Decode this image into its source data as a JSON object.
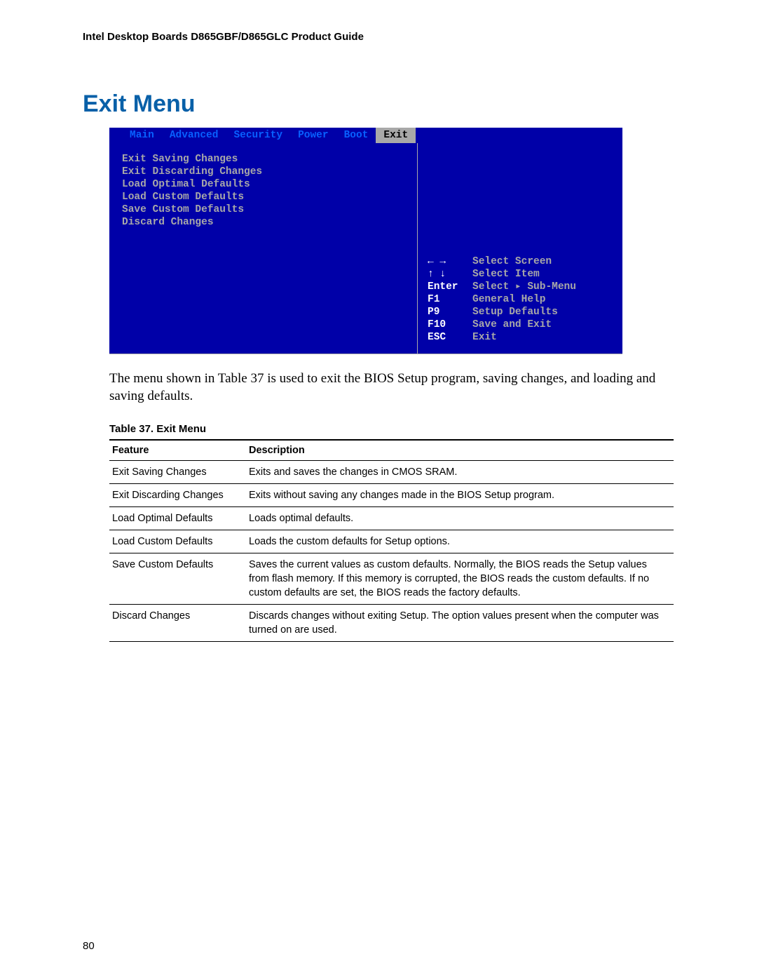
{
  "header": "Intel Desktop Boards D865GBF/D865GLC Product Guide",
  "section_title": "Exit Menu",
  "bios": {
    "tabs": [
      "Main",
      "Advanced",
      "Security",
      "Power",
      "Boot",
      "Exit"
    ],
    "active_tab_index": 5,
    "menu_items": [
      "Exit Saving Changes",
      "Exit Discarding Changes",
      "Load Optimal Defaults",
      "Load Custom Defaults",
      "Save Custom Defaults",
      "Discard Changes"
    ],
    "help": [
      {
        "key": "←  →",
        "label": "Select Screen"
      },
      {
        "key": "↑  ↓",
        "label": "Select Item"
      },
      {
        "key": "Enter",
        "label": "Select ▸ Sub-Menu"
      },
      {
        "key": "F1",
        "label": "General Help"
      },
      {
        "key": "P9",
        "label": "Setup Defaults"
      },
      {
        "key": "F10",
        "label": "Save and Exit"
      },
      {
        "key": "ESC",
        "label": "Exit"
      }
    ]
  },
  "caption": "The menu shown in Table 37 is used to exit the BIOS Setup program, saving changes, and loading and saving defaults.",
  "table_title": "Table 37.    Exit Menu",
  "table_headers": [
    "Feature",
    "Description"
  ],
  "table_rows": [
    {
      "feature": "Exit Saving Changes",
      "desc": "Exits and saves the changes in CMOS SRAM."
    },
    {
      "feature": "Exit Discarding Changes",
      "desc": "Exits without saving any changes made in the BIOS Setup program."
    },
    {
      "feature": "Load Optimal Defaults",
      "desc": "Loads optimal defaults."
    },
    {
      "feature": "Load Custom Defaults",
      "desc": "Loads the custom defaults for Setup options."
    },
    {
      "feature": "Save Custom Defaults",
      "desc": "Saves the current values as custom defaults.  Normally, the BIOS reads the Setup values from flash memory.  If this memory is corrupted, the BIOS reads the custom defaults.  If no custom defaults are set, the BIOS reads the factory defaults."
    },
    {
      "feature": "Discard Changes",
      "desc": "Discards changes without exiting Setup.  The option values present when the computer was turned on are used."
    }
  ],
  "page_number": "80"
}
